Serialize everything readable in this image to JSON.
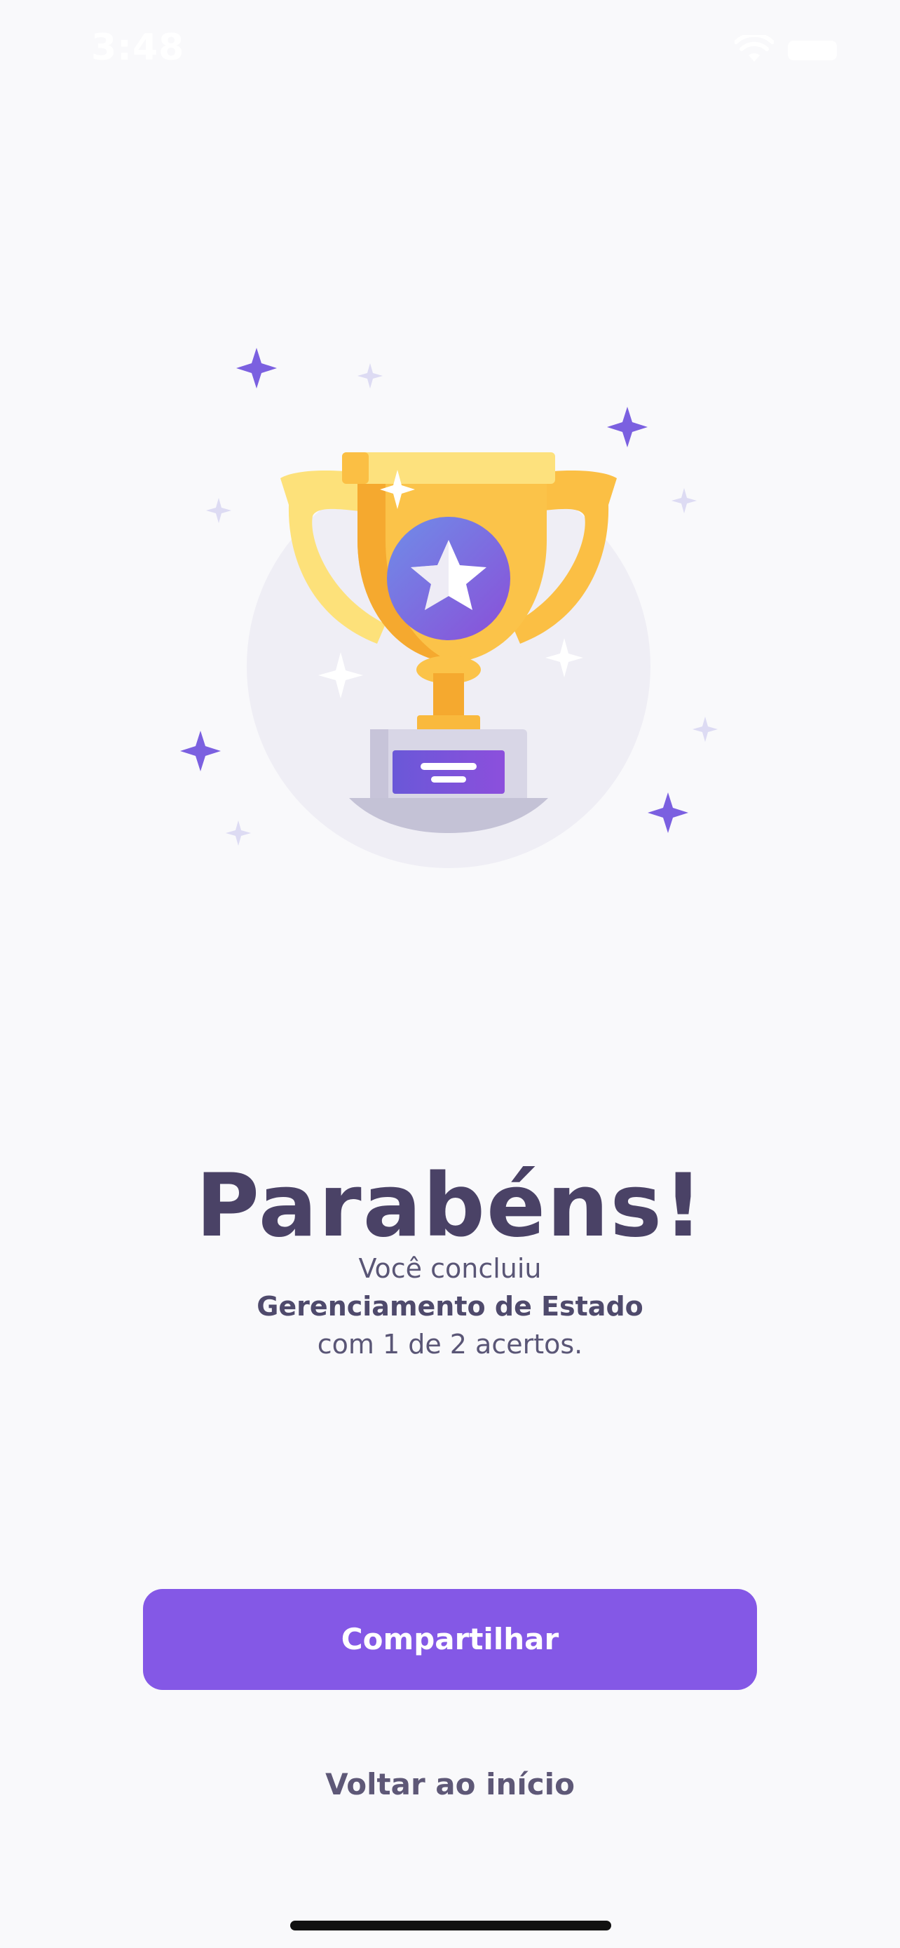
{
  "status_bar": {
    "time": "3:48",
    "icons": [
      "wifi-icon",
      "battery-icon"
    ]
  },
  "illustration": {
    "icon": "trophy-icon",
    "decorations": [
      "sparkle-icon"
    ],
    "colors": {
      "trophy_gold": "#f9b93d",
      "trophy_light": "#fdd565",
      "medal_purple": "#7d5bdb",
      "medal_blue": "#6f8de8",
      "base_gray": "#c4c2d6",
      "sparkle_purple": "#7b60e0"
    }
  },
  "result": {
    "title": "Parabéns!",
    "line1": "Você concluiu",
    "course": "Gerenciamento de Estado",
    "line3": "com 1 de 2 acertos."
  },
  "actions": {
    "share_label": "Compartilhar",
    "home_label": "Voltar ao início"
  },
  "colors": {
    "background": "#f9f9fb",
    "title": "#4a4266",
    "primary_button": "#8458e6",
    "primary_button_text": "#ffffff",
    "secondary_text": "#5e5877"
  }
}
